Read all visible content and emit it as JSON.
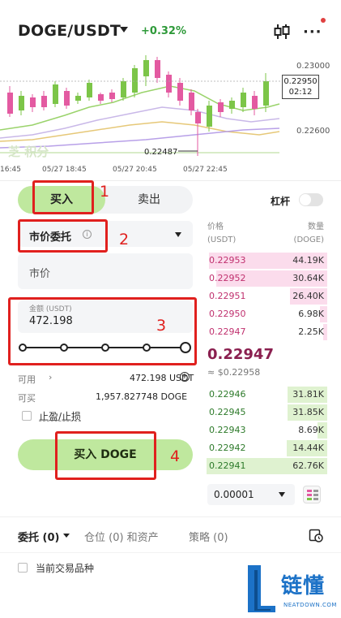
{
  "header": {
    "pair": "DOGE/USDT",
    "change": "+0.32%",
    "icons": [
      "chevron-down-icon",
      "candlestick-icon",
      "more-icon"
    ]
  },
  "chart": {
    "y_labels": [
      "0.23000",
      "0.22600"
    ],
    "price_tag": "0.22950",
    "countdown": "02:12",
    "low_label": "0.22487",
    "time_labels": [
      "16:45",
      "05/27 18:45",
      "05/27 20:45",
      "05/27 22:45"
    ],
    "watermark": "芝 积分"
  },
  "trade": {
    "buy_tab": "买入",
    "sell_tab": "卖出",
    "leverage_label": "杠杆",
    "order_type": "市价委托",
    "market_label": "市价",
    "amount_label": "金额 (USDT)",
    "amount_value": "472.198",
    "available_label": "可用",
    "available_value": "472.198 USDT",
    "can_buy_label": "可买",
    "can_buy_value": "1,957.827748 DOGE",
    "tpsl_label": "止盈/止损",
    "buy_button": "买入 DOGE",
    "slider_percent": 100
  },
  "orderbook": {
    "price_header": [
      "价格",
      "(USDT)"
    ],
    "qty_header": [
      "数量",
      "(DOGE)"
    ],
    "asks": [
      {
        "price": "0.22953",
        "qty": "44.19K",
        "depth": 0.96
      },
      {
        "price": "0.22952",
        "qty": "30.64K",
        "depth": 0.9
      },
      {
        "price": "0.22951",
        "qty": "26.40K",
        "depth": 0.3
      },
      {
        "price": "0.22950",
        "qty": "6.98K",
        "depth": 0.06
      },
      {
        "price": "0.22947",
        "qty": "2.25K",
        "depth": 0.03
      }
    ],
    "last_price": "0.22947",
    "last_fiat": "≈ $0.22958",
    "bids": [
      {
        "price": "0.22946",
        "qty": "31.81K",
        "depth": 0.32
      },
      {
        "price": "0.22945",
        "qty": "31.85K",
        "depth": 0.32
      },
      {
        "price": "0.22943",
        "qty": "8.69K",
        "depth": 0.08
      },
      {
        "price": "0.22942",
        "qty": "14.44K",
        "depth": 0.33
      },
      {
        "price": "0.22941",
        "qty": "62.76K",
        "depth": 0.98
      }
    ],
    "precision": "0.00001"
  },
  "tabs": {
    "orders": "委托 (0)",
    "positions": "仓位 (0) 和资产",
    "strategy": "策略 (0)"
  },
  "footer": {
    "current_pair_label": "当前交易品种"
  },
  "annotations": [
    "1",
    "2",
    "3",
    "4"
  ],
  "logo": {
    "text": "链懂",
    "sub": "NEATDOWN.COM"
  },
  "colors": {
    "buy": "#bfe89e",
    "ask_text": "#c0306e",
    "bid_text": "#2d7a2a",
    "annotation": "#e0201e",
    "logo": "#1c72c7"
  }
}
